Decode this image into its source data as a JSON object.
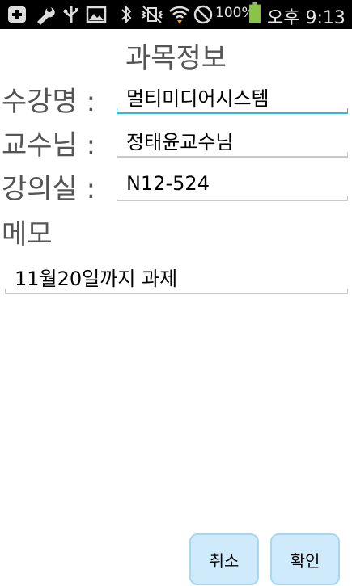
{
  "status_bar": {
    "icons": [
      "add-box-icon",
      "wrench-icon",
      "usb-icon",
      "image-icon",
      "bluetooth-icon",
      "vibrate-off-icon",
      "wifi-icon",
      "no-signal-icon"
    ],
    "battery_percent": "100%",
    "time": "오후 9:13",
    "battery_color": "#8bc34a"
  },
  "form": {
    "title": "과목정보",
    "subject_label": "수강명 :",
    "subject_value": "멀티미디어시스템",
    "professor_label": "교수님 :",
    "professor_value": "정태윤교수님",
    "room_label": "강의실 :",
    "room_value": "N12-524",
    "memo_label": "메모",
    "memo_value": "11월20일까지 과제"
  },
  "buttons": {
    "cancel": "취소",
    "ok": "확인"
  },
  "colors": {
    "accent": "#33b5e5",
    "button_bg": "#cfeafa"
  }
}
